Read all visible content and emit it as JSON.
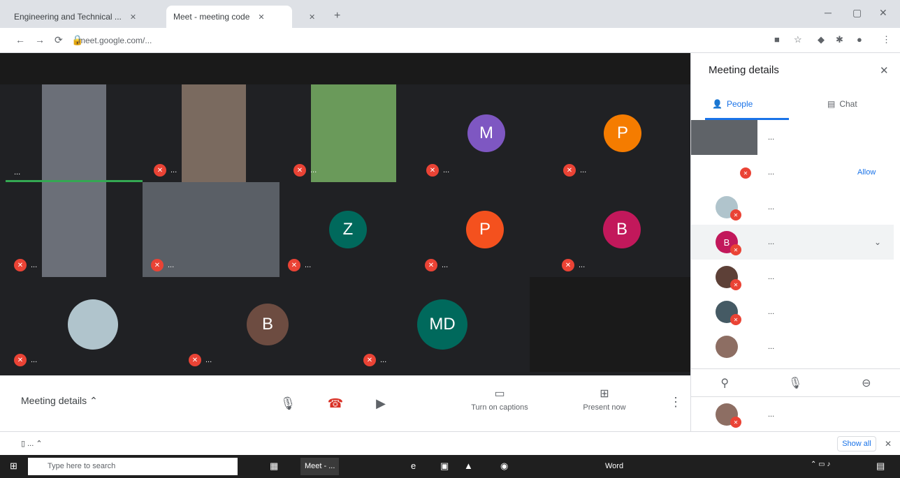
{
  "browser": {
    "tabs": [
      {
        "label": "Engineering and Technical ..."
      },
      {
        "label": "Meet - meeting code"
      },
      {
        "label": ""
      }
    ],
    "new_tab": "+",
    "url": "meet.google.com/..."
  },
  "stage": {
    "tiles": [
      {
        "name": "...",
        "initial": ""
      },
      {
        "name": "...",
        "initial": ""
      },
      {
        "name": "...",
        "initial": ""
      },
      {
        "name": "...",
        "initial": "M",
        "color": "#7e57c2"
      },
      {
        "name": "...",
        "initial": "P",
        "color": "#f57c00"
      },
      {
        "name": "...",
        "initial": ""
      },
      {
        "name": "...",
        "initial": ""
      },
      {
        "name": "...",
        "initial": "Z",
        "color": "#00695c"
      },
      {
        "name": "...",
        "initial": "P",
        "color": "#f4511e"
      },
      {
        "name": "...",
        "initial": "B",
        "color": "#c2185b"
      },
      {
        "name": "...",
        "initial": ""
      },
      {
        "name": "...",
        "initial": "B",
        "color": "#6d4c41"
      },
      {
        "name": "...",
        "initial": "MD",
        "color": "#00695c"
      }
    ]
  },
  "controls": {
    "meeting_details": "Meeting details",
    "captions": "Turn on captions",
    "present": "Present now"
  },
  "panel": {
    "title": "Meeting details",
    "tab_people": "People",
    "tab_chat": "Chat",
    "allow": "Allow",
    "participants": [
      {
        "name": "...",
        "initial": ""
      },
      {
        "name": "...",
        "initial": ""
      },
      {
        "name": "...",
        "initial": ""
      },
      {
        "name": "...",
        "initial": "B",
        "color": "#c2185b"
      },
      {
        "name": "...",
        "initial": ""
      },
      {
        "name": "...",
        "initial": ""
      },
      {
        "name": "...",
        "initial": ""
      },
      {
        "name": "...",
        "initial": ""
      }
    ]
  },
  "downloads": {
    "file": "...",
    "show_all": "Show all"
  },
  "taskbar": {
    "search": "Type here to search",
    "apps": [
      "Meet - ...",
      "Word"
    ]
  }
}
